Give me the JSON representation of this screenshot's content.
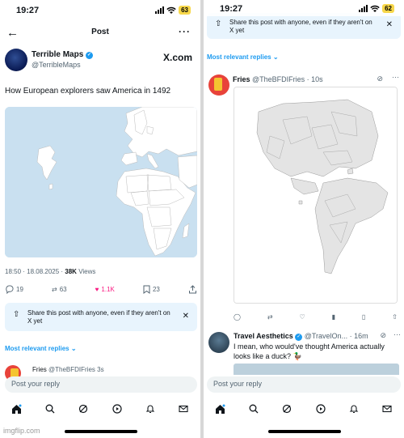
{
  "left": {
    "status": {
      "time": "19:27",
      "battery": "63"
    },
    "header": {
      "title": "Post",
      "back_icon": "arrow-left-icon",
      "more_icon": "ellipsis-icon"
    },
    "author": {
      "name": "Terrible Maps",
      "handle": "@TerribleMaps",
      "logo": "X.com"
    },
    "post": {
      "text": "How European explorers saw America in 1492",
      "timestamp": "18:50 · 18.08.2025 · ",
      "views": "38K",
      "views_label": " Views"
    },
    "actions": {
      "replies": "19",
      "reposts": "63",
      "likes": "1.1K",
      "bookmarks": "23"
    },
    "share_prompt": {
      "text": "Share this post with anyone, even if they aren't on X yet"
    },
    "sort": {
      "label": "Most relevant replies"
    },
    "next_reply": {
      "name": "Fries",
      "handle": "@TheBFDIFries",
      "age": "3s"
    },
    "compose": {
      "placeholder": "Post your reply"
    }
  },
  "right": {
    "status": {
      "time": "19:27",
      "battery": "62"
    },
    "share_prompt": {
      "text": "Share this post with anyone, even if they aren't on X yet"
    },
    "sort": {
      "label": "Most relevant replies"
    },
    "reply1": {
      "name": "Fries",
      "handle": "@TheBFDIFries · 10s"
    },
    "reply2": {
      "name": "Travel Aesthetics",
      "handle": "@TravelOn... · 16m",
      "text": "I mean, who would've thought America actually looks like a duck? 🦆"
    },
    "compose": {
      "placeholder": "Post your reply"
    }
  },
  "watermark": "imgflip.com",
  "colors": {
    "accent": "#1d9bf0",
    "like": "#f91880",
    "ocean": "#c9e0f0",
    "share_bg": "#e8f4fd"
  }
}
